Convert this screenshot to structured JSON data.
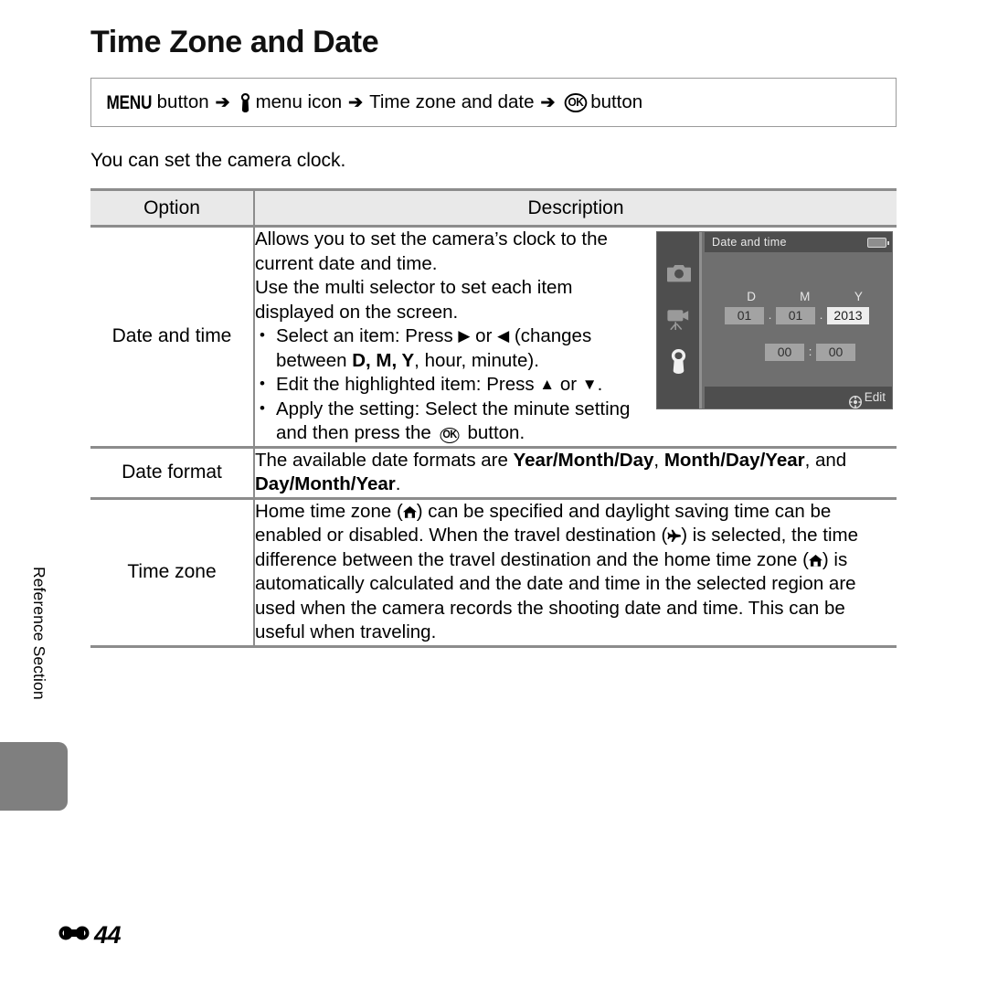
{
  "page": {
    "title": "Time Zone and Date",
    "side_label": "Reference Section",
    "page_number": "44",
    "page_marker_icon": "reference-section-icon"
  },
  "nav_path": {
    "menu_button_glyph": "MENU",
    "menu_button_label": " button",
    "arrow": "➔",
    "setup_menu_icon": "wrench-icon",
    "menu_icon_label": "menu icon",
    "item_label": "Time zone and date",
    "ok_button_glyph": "OK",
    "ok_button_label": "button"
  },
  "intro": "You can set the camera clock.",
  "table": {
    "headers": {
      "option": "Option",
      "description": "Description"
    },
    "rows": [
      {
        "option": "Date and time",
        "description_lines": [
          "Allows you to set the camera’s clock to the",
          "current date and time.",
          "Use the multi selector to set each item",
          "displayed on the screen."
        ],
        "bullets": [
          {
            "prefix": "Select an item: Press ",
            "icon_right": "right-triangle-icon",
            "mid": " or ",
            "icon_left": "left-triangle-icon",
            "suffix": " (changes between ",
            "bold_items": "D, M, Y",
            "tail": ", hour, minute)."
          },
          {
            "prefix": "Edit the highlighted item: Press ",
            "icon_up": "up-triangle-icon",
            "mid": " or ",
            "icon_down": "down-triangle-icon",
            "tail": "."
          },
          {
            "prefix": "Apply the setting: Select the minute setting and then press the ",
            "ok_glyph": "OK",
            "tail": " button."
          }
        ]
      },
      {
        "option": "Date format",
        "text_before": "The available date formats are ",
        "bold1": "Year/Month/Day",
        "between1": ", ",
        "bold2": "Month/Day/Year",
        "between2": ", and ",
        "bold3": "Day/Month/Year",
        "tail": "."
      },
      {
        "option": "Time zone",
        "seg1": "Home time zone (",
        "icon_home_1": "home-icon",
        "seg2": ") can be specified and daylight saving time can be enabled or disabled. When the travel destination (",
        "icon_plane": "airplane-icon",
        "seg3": ") is selected, the time difference between the travel destination and the home time zone (",
        "icon_home_2": "home-icon",
        "seg4": ") is automatically calculated and the date and time in the selected region are used when the camera records the shooting date and time. This can be useful when traveling."
      }
    ]
  },
  "lcd": {
    "title": "Date and time",
    "battery_icon": "battery-icon",
    "side_icons": [
      "camera-icon",
      "movie-camera-icon",
      "wrench-icon"
    ],
    "selected_side_icon": "wrench-icon",
    "labels": {
      "day": "D",
      "month": "M",
      "year": "Y"
    },
    "date": {
      "day": "01",
      "month": "01",
      "year": "2013"
    },
    "date_separator": ".",
    "time": {
      "hour": "00",
      "minute": "00"
    },
    "time_separator": ":",
    "selected_field": "year",
    "footer_icon": "multi-selector-icon",
    "footer_label": "Edit"
  },
  "colors": {
    "rule": "#8c8c8c",
    "header_bg": "#e9e9e9",
    "side_tab": "#7f7f7f",
    "lcd_bg": "#6f6f6f",
    "lcd_panel": "#4e4e4e",
    "field": "#a3a3a3",
    "field_selected": "#ededed"
  }
}
